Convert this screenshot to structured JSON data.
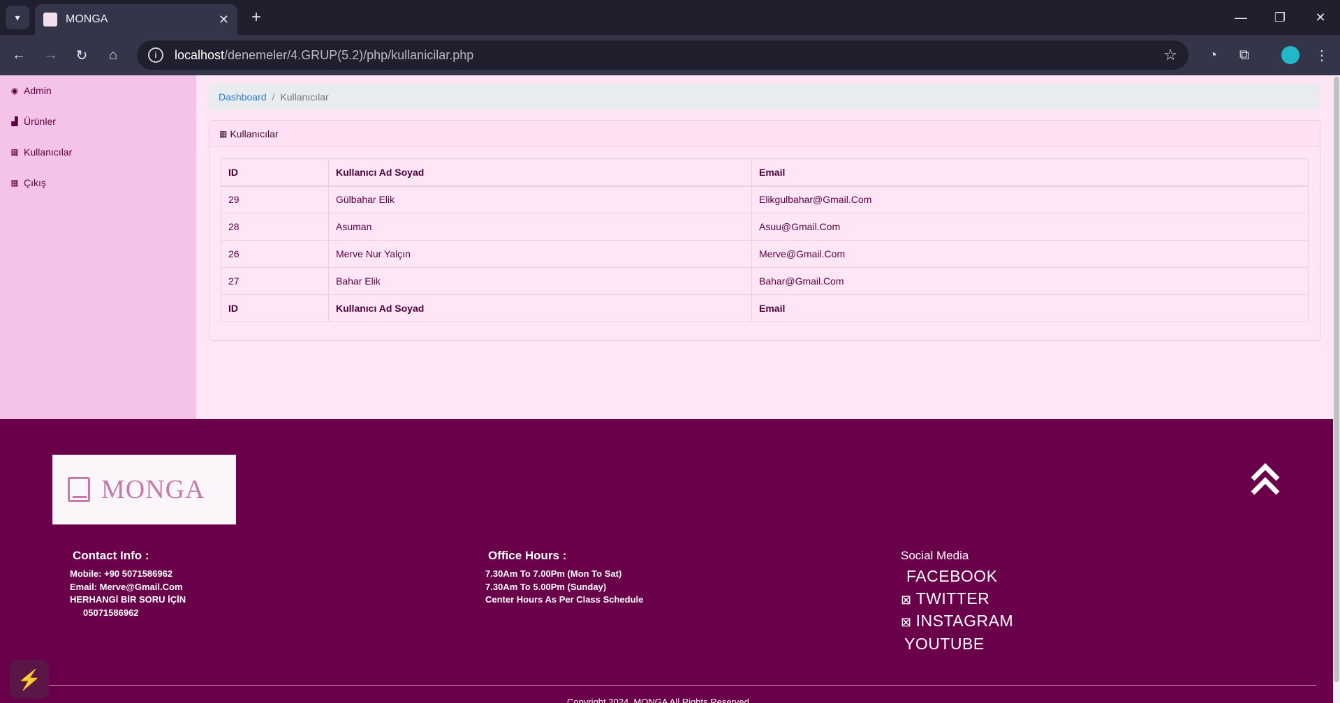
{
  "browser": {
    "tab_title": "MONGA",
    "url_host": "localhost",
    "url_path": "/denemeler/4.GRUP(5.2)/php/kullanicilar.php"
  },
  "sidebar": {
    "items": [
      {
        "label": "Admin",
        "icon": "dashboard-icon"
      },
      {
        "label": "Ürünler",
        "icon": "chart-icon"
      },
      {
        "label": "Kullanıcılar",
        "icon": "table-icon"
      },
      {
        "label": "Çıkış",
        "icon": "table-icon"
      }
    ]
  },
  "breadcrumb": {
    "home": "Dashboard",
    "separator": "/",
    "current": "Kullanıcılar"
  },
  "card": {
    "title": "Kullanıcılar"
  },
  "table": {
    "headers": [
      "ID",
      "Kullanıcı Ad Soyad",
      "Email"
    ],
    "rows": [
      [
        "29",
        "Gülbahar Elik",
        "Elikgulbahar@Gmail.Com"
      ],
      [
        "28",
        "Asuman",
        "Asuu@Gmail.Com"
      ],
      [
        "26",
        "Merve Nur Yalçın",
        "Merve@Gmail.Com"
      ],
      [
        "27",
        "Bahar Elik",
        "Bahar@Gmail.Com"
      ]
    ],
    "footers": [
      "ID",
      "Kullanıcı Ad Soyad",
      "Email"
    ]
  },
  "footer": {
    "logo_text": "MONGA",
    "contact": {
      "title": "Contact Info :",
      "mobile": "Mobile: +90 5071586962",
      "email": "Email: Merve@Gmail.Com",
      "question": "HERHANGİ BİR SORU İÇİN",
      "phone": "05071586962"
    },
    "office": {
      "title": "Office Hours :",
      "line1": "7.30Am To 7.00Pm (Mon To Sat)",
      "line2": "7.30Am To 5.00Pm (Sunday)",
      "line3": "Center Hours As Per Class Schedule"
    },
    "social": {
      "title": "Social Media",
      "facebook": "FACEBOOK",
      "twitter": "TWITTER",
      "instagram": "INSTAGRAM",
      "youtube": "YOUTUBE"
    },
    "copyright": "Copyright     2024. MONGA All Rights Reserved"
  },
  "colors": {
    "sidebar": "#f6c3e8",
    "page": "#ffe6f7",
    "footer": "#6a004a",
    "accent": "#c77aa8"
  }
}
